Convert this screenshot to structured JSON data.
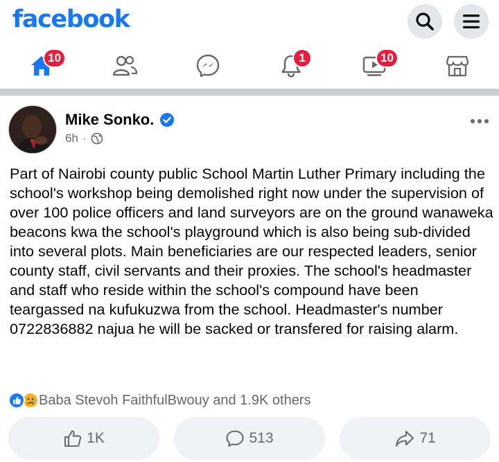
{
  "app": {
    "logo": "facebook",
    "brand_color": "#1877f2"
  },
  "header": {
    "search_icon": "search-icon",
    "menu_icon": "menu-icon"
  },
  "nav": {
    "home_badge": "10",
    "notifications_badge": "1",
    "watch_badge": "10",
    "badge_color": "#e41e3f",
    "icons": [
      "home-icon",
      "friends-icon",
      "messenger-icon",
      "bell-icon",
      "video-icon",
      "marketplace-icon"
    ]
  },
  "post": {
    "author": "Mike Sonko.",
    "time": "6h",
    "separator": "·",
    "privacy_icon": "globe-icon",
    "text": "Part of Nairobi county public School Martin Luther Primary including the school's workshop being demolished right now under the supervision of over 100 police officers and land surveyors are on the ground wanaweka beacons kwa the school's playground which is also being sub-divided into several plots. Main beneficiaries are our respected leaders, senior county staff, civil servants and their proxies. The school's headmaster and staff who reside within the school's compound have been teargassed na kufukuzwa from the school. Headmaster's number 0722836882 najua he will be sacked or transfered for raising alarm.",
    "reactions_text": "Baba Stevoh FaithfulBwouy and 1.9K others",
    "likes": "1K",
    "comments": "513",
    "shares": "71"
  }
}
